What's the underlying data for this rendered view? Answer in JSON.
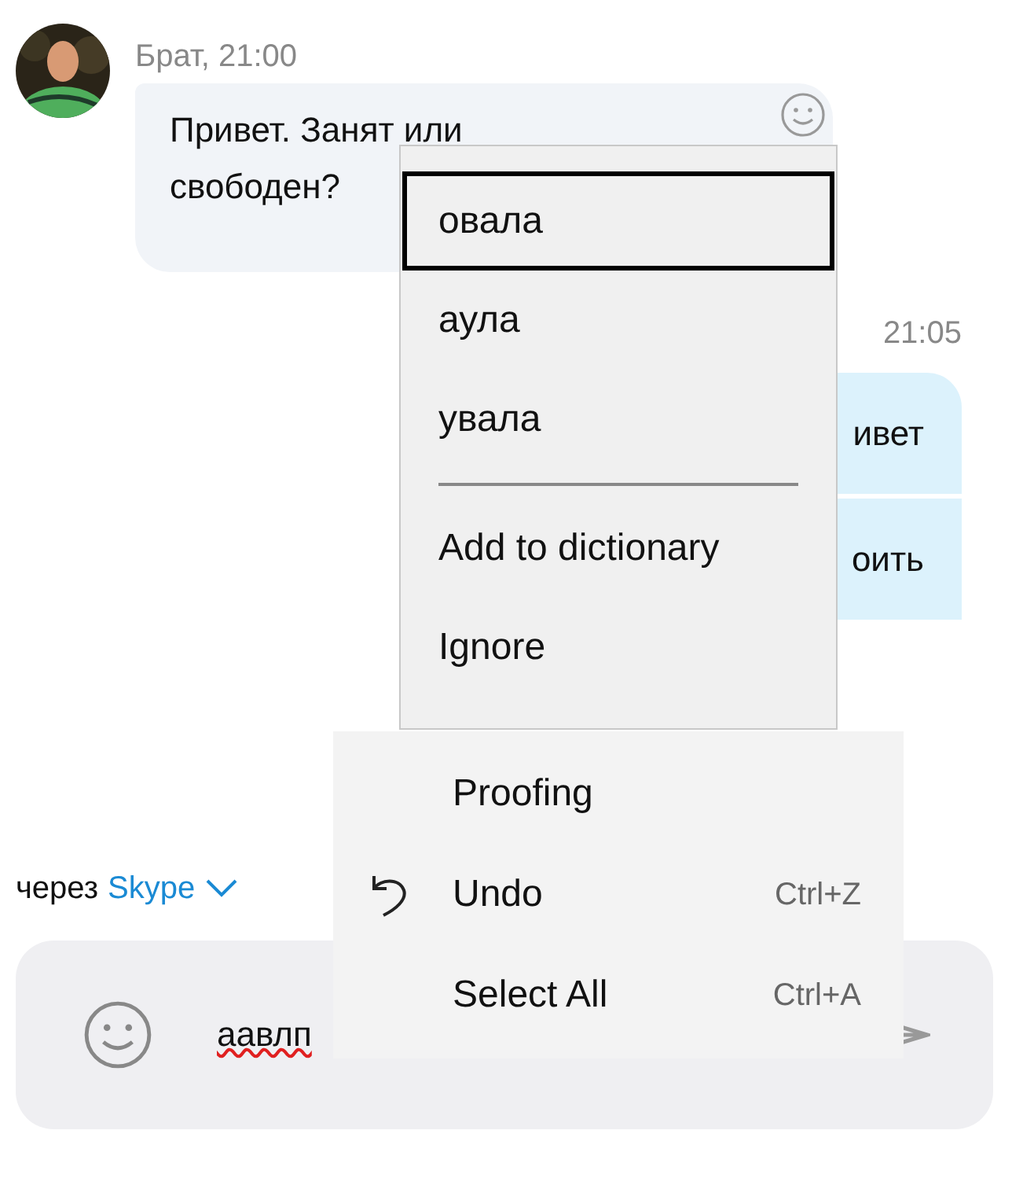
{
  "incoming_message": {
    "sender_time": "Брат, 21:00",
    "text": "Привет. Занят или\nсвободен?"
  },
  "outgoing_messages": {
    "time": "21:05",
    "bubbles": [
      "ивет",
      "оить"
    ]
  },
  "via": {
    "prefix": "через",
    "service": "Skype"
  },
  "composer": {
    "value": "аавлп",
    "misspelled": true
  },
  "spelling_menu": {
    "items": [
      {
        "kind": "suggestion",
        "label": "овала",
        "selected": true
      },
      {
        "kind": "suggestion",
        "label": "аула",
        "selected": false
      },
      {
        "kind": "suggestion",
        "label": "увала",
        "selected": false
      },
      {
        "kind": "separator"
      },
      {
        "kind": "command",
        "label": "Add to dictionary",
        "selected": false
      },
      {
        "kind": "command",
        "label": "Ignore",
        "selected": false
      }
    ]
  },
  "context_menu": {
    "items": [
      {
        "kind": "plain",
        "label": "Proofing"
      },
      {
        "kind": "with_icon",
        "label": "Undo",
        "shortcut": "Ctrl+Z"
      },
      {
        "kind": "plain",
        "label": "Select All",
        "shortcut": "Ctrl+A"
      }
    ]
  }
}
